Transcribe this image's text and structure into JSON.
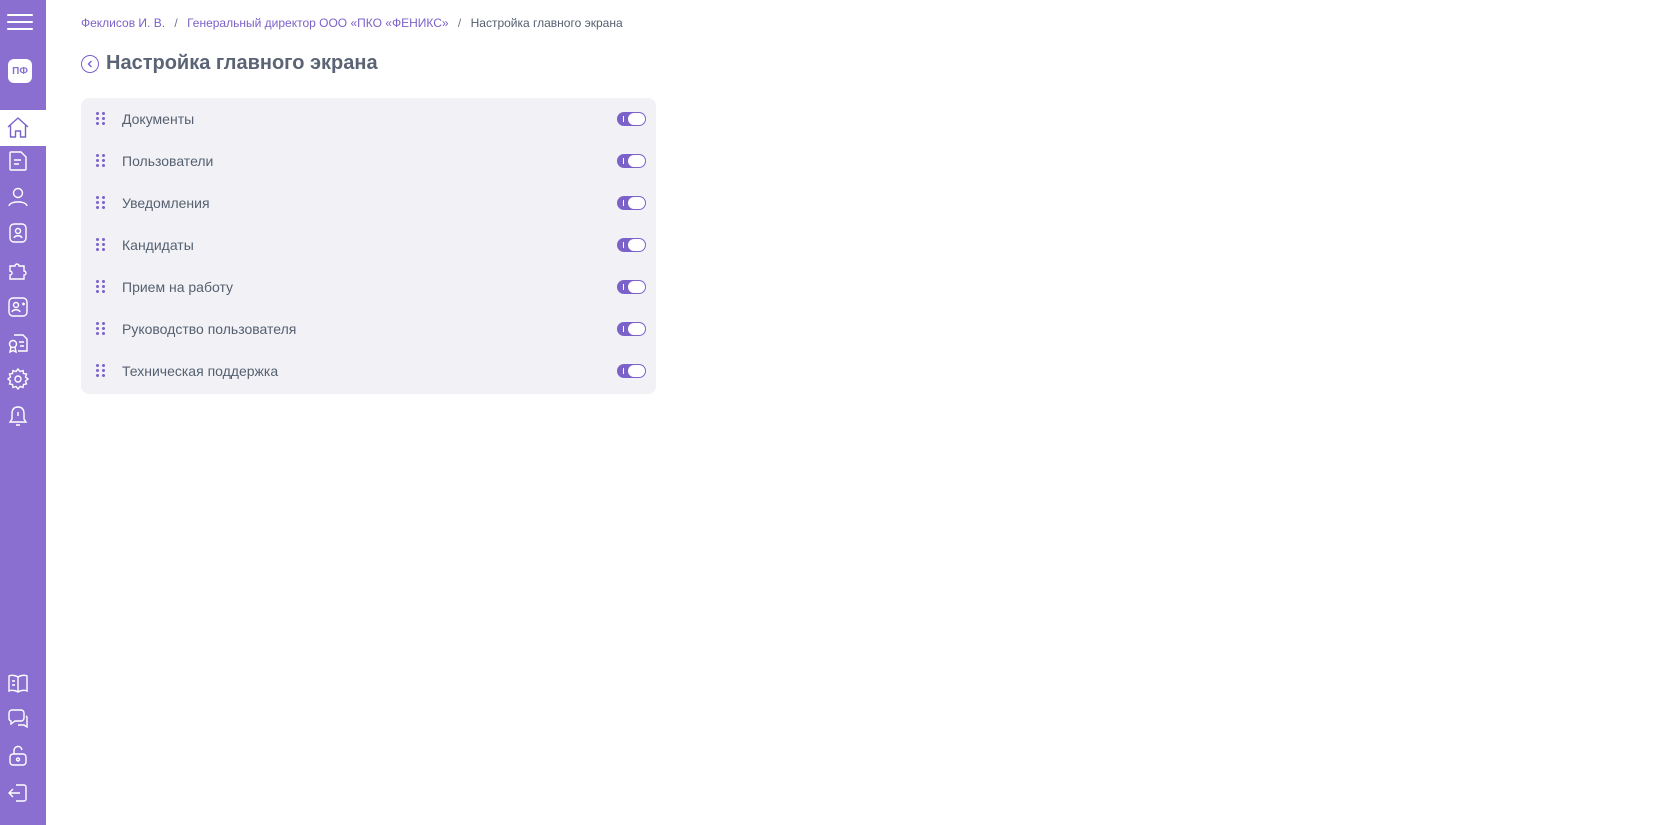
{
  "sidebar": {
    "logo": "ПФ",
    "icons": [
      "home-icon",
      "documents-icon",
      "user-icon",
      "badge-icon",
      "puzzle-icon",
      "add-user-icon",
      "certificate-icon",
      "gear-icon",
      "bell-icon",
      "book-icon",
      "chat-icon",
      "unlock-icon",
      "logout-icon"
    ]
  },
  "breadcrumb": {
    "items": [
      "Феклисов И. В.",
      "Генеральный директор ООО «ПКО «ФЕНИКС»"
    ],
    "separator": "/",
    "current": "Настройка главного экрана"
  },
  "page": {
    "title": "Настройка главного экрана"
  },
  "settings": {
    "items": [
      {
        "label": "Документы",
        "enabled": true
      },
      {
        "label": "Пользователи",
        "enabled": true
      },
      {
        "label": "Уведомления",
        "enabled": true
      },
      {
        "label": "Кандидаты",
        "enabled": true
      },
      {
        "label": "Прием на работу",
        "enabled": true
      },
      {
        "label": "Руководство пользователя",
        "enabled": true
      },
      {
        "label": "Техническая поддержка",
        "enabled": true
      }
    ]
  },
  "colors": {
    "accent": "#7b62c9",
    "sidebar": "#8a6fd0",
    "card": "#f2f2f6",
    "text": "#556070"
  }
}
